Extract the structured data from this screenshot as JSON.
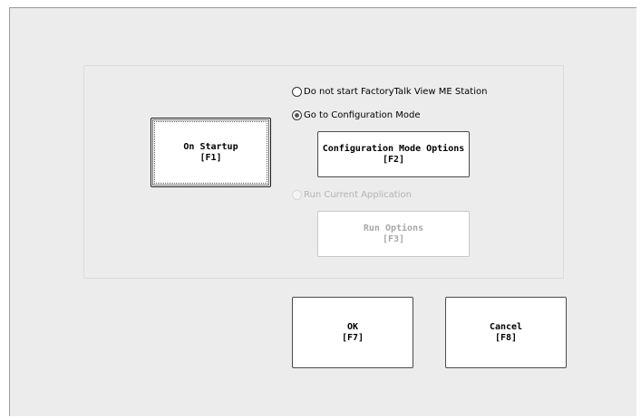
{
  "startup_button": {
    "line1": "On Startup",
    "line2": "[F1]"
  },
  "options": [
    {
      "label": "Do not start FactoryTalk View ME Station",
      "selected": false,
      "enabled": true
    },
    {
      "label": "Go to Configuration Mode",
      "selected": true,
      "enabled": true
    },
    {
      "label": "Run Current Application",
      "selected": false,
      "enabled": false
    }
  ],
  "config_button": {
    "line1": "Configuration Mode Options",
    "line2": "[F2]"
  },
  "run_button": {
    "line1": "Run Options",
    "line2": "[F3]",
    "enabled": false
  },
  "ok_button": {
    "line1": "OK",
    "line2": "[F7]"
  },
  "cancel_button": {
    "line1": "Cancel",
    "line2": "[F8]"
  },
  "colors": {
    "panel_background": "#ececec",
    "button_background": "#ffffff",
    "disabled_text": "#a8a8a8"
  }
}
